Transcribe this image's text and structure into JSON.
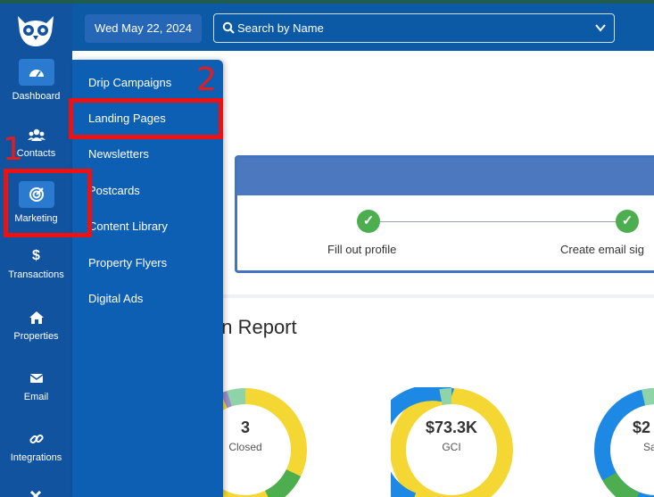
{
  "header": {
    "date": "Wed May 22, 2024",
    "search_placeholder": "Search by Name"
  },
  "sidebar": {
    "items": [
      {
        "label": "Dashboard",
        "icon": "dashboard-icon"
      },
      {
        "label": "Contacts",
        "icon": "contacts-icon"
      },
      {
        "label": "Marketing",
        "icon": "target-icon"
      },
      {
        "label": "Transactions",
        "icon": "dollar-icon"
      },
      {
        "label": "Properties",
        "icon": "home-icon"
      },
      {
        "label": "Email",
        "icon": "envelope-icon"
      },
      {
        "label": "Integrations",
        "icon": "link-icon"
      }
    ]
  },
  "marketing_menu": {
    "items": [
      "Drip Campaigns",
      "Landing Pages",
      "Newsletters",
      "Postcards",
      "Content Library",
      "Property Flyers",
      "Digital Ads"
    ]
  },
  "onboarding": {
    "steps": [
      "Fill out profile",
      "Create email sig"
    ]
  },
  "report": {
    "title": "on Report",
    "metrics": [
      {
        "value": "3",
        "label": "Closed"
      },
      {
        "value": "$73.3K",
        "label": "GCI"
      },
      {
        "value": "$2",
        "label": "Sa"
      }
    ]
  },
  "annotations": [
    "1",
    "2"
  ],
  "colors": {
    "rail": "#1253a0",
    "topbar": "#0c5aa6",
    "flyout": "#0d5fb3",
    "highlight": "#ee1111",
    "check": "#4cae4f"
  }
}
